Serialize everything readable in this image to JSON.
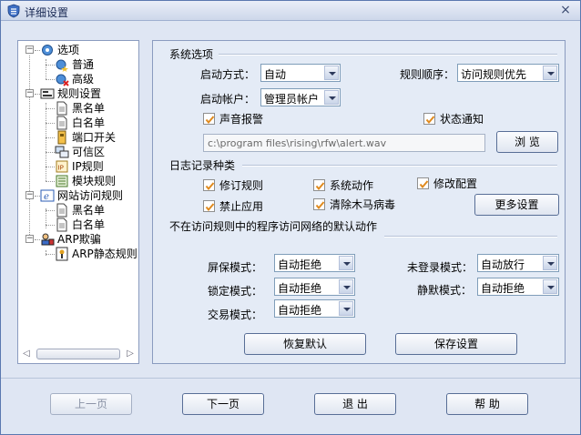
{
  "window": {
    "title": "详细设置",
    "close_label": "×"
  },
  "tree": {
    "items": [
      {
        "label": "选项",
        "icon": "gear-icon"
      },
      {
        "label": "普通",
        "icon": "gear-star-icon"
      },
      {
        "label": "高级",
        "icon": "gear-red-icon"
      },
      {
        "label": "规则设置",
        "icon": "rules-icon"
      },
      {
        "label": "黑名单",
        "icon": "document-icon"
      },
      {
        "label": "白名单",
        "icon": "document-icon"
      },
      {
        "label": "端口开关",
        "icon": "port-icon"
      },
      {
        "label": "可信区",
        "icon": "network-icon"
      },
      {
        "label": "IP规则",
        "icon": "ip-icon"
      },
      {
        "label": "模块规则",
        "icon": "module-icon"
      },
      {
        "label": "网站访问规则",
        "icon": "ie-icon"
      },
      {
        "label": "黑名单",
        "icon": "document-icon"
      },
      {
        "label": "白名单",
        "icon": "document-icon"
      },
      {
        "label": "ARP欺骗",
        "icon": "arp-icon"
      },
      {
        "label": "ARP静态规则",
        "icon": "arp-static-icon"
      }
    ],
    "expander_minus": "−",
    "scroll_left": "◁",
    "scroll_right": "▷"
  },
  "system": {
    "title": "系统选项",
    "startup_mode_label": "启动方式：",
    "startup_mode_value": "自动",
    "rule_order_label": "规则顺序：",
    "rule_order_value": "访问规则优先",
    "startup_account_label": "启动帐户：",
    "startup_account_value": "管理员帐户",
    "sound_alarm_label": "声音报警",
    "status_notify_label": "状态通知",
    "sound_path": "c:\\program files\\rising\\rfw\\alert.wav",
    "browse_label": "浏 览"
  },
  "log": {
    "title": "日志记录种类",
    "revise_rule_label": "修订规则",
    "system_action_label": "系统动作",
    "modify_config_label": "修改配置",
    "forbid_app_label": "禁止应用",
    "remove_trojan_label": "清除木马病毒",
    "more_settings_label": "更多设置"
  },
  "default_action": {
    "title": "不在访问规则中的程序访问网络的默认动作",
    "screensaver_label": "屏保模式：",
    "screensaver_value": "自动拒绝",
    "not_logged_label": "未登录模式：",
    "not_logged_value": "自动放行",
    "lock_label": "锁定模式：",
    "lock_value": "自动拒绝",
    "silent_label": "静默模式：",
    "silent_value": "自动拒绝",
    "trade_label": "交易模式：",
    "trade_value": "自动拒绝",
    "restore_default_label": "恢复默认",
    "save_settings_label": "保存设置"
  },
  "footer": {
    "prev_label": "上一页",
    "next_label": "下一页",
    "exit_label": "退 出",
    "help_label": "帮 助"
  },
  "colors": {
    "accent": "#5a78b0",
    "check": "#e08a1e",
    "panel_bg": "#e4ebf6"
  }
}
